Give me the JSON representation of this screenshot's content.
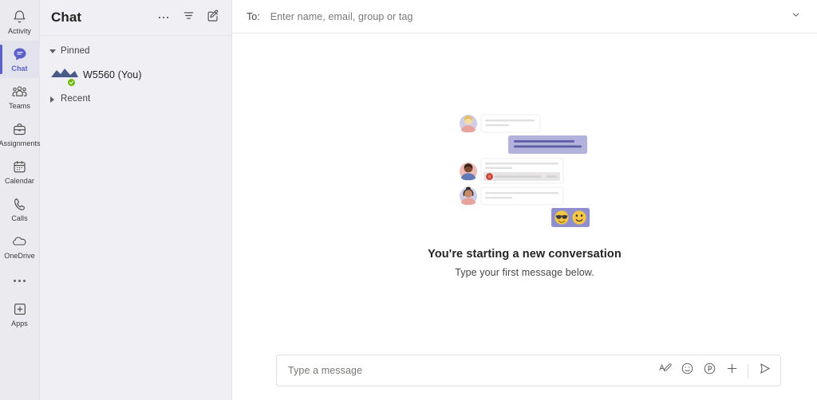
{
  "app": {
    "accent_color": "#5b5fc7",
    "rail_bg": "#ebebef",
    "list_bg": "#f0f0f4",
    "main_bg": "#ffffff"
  },
  "rail": {
    "items": [
      {
        "label": "Activity",
        "icon": "bell-icon",
        "active": false
      },
      {
        "label": "Chat",
        "icon": "chat-bubble-icon",
        "active": true
      },
      {
        "label": "Teams",
        "icon": "teams-people-icon",
        "active": false
      },
      {
        "label": "Assignments",
        "icon": "assignments-bag-icon",
        "active": false
      },
      {
        "label": "Calendar",
        "icon": "calendar-icon",
        "active": false
      },
      {
        "label": "Calls",
        "icon": "phone-icon",
        "active": false
      },
      {
        "label": "OneDrive",
        "icon": "cloud-icon",
        "active": false
      }
    ],
    "more_icon": "ellipsis-icon",
    "apps": {
      "label": "Apps",
      "icon": "apps-plus-box-icon"
    }
  },
  "chat_list": {
    "title": "Chat",
    "header_actions": [
      {
        "name": "more-options",
        "icon": "ellipsis-icon",
        "tooltip": "More options"
      },
      {
        "name": "filter",
        "icon": "filter-icon",
        "tooltip": "Filter"
      },
      {
        "name": "new-chat",
        "icon": "compose-pencil-icon",
        "tooltip": "New chat"
      }
    ],
    "groups": [
      {
        "label": "Pinned",
        "expanded": true,
        "chevron": "triangle-down-icon",
        "items": [
          {
            "name": "W5560 (You)",
            "avatar": "landscape-photo-avatar",
            "presence": "available"
          }
        ]
      },
      {
        "label": "Recent",
        "expanded": false,
        "chevron": "triangle-right-icon",
        "items": []
      }
    ]
  },
  "main": {
    "to_bar": {
      "label": "To:",
      "value": "",
      "placeholder": "Enter name, email, group or tag",
      "expand_icon": "chevron-down-icon"
    },
    "empty_state": {
      "illustration": "new-conversation-illustration",
      "title": "You're starting a new conversation",
      "subtitle": "Type your first message below."
    },
    "composer": {
      "value": "",
      "placeholder": "Type a message",
      "actions": [
        {
          "name": "format",
          "icon": "format-pencil-icon"
        },
        {
          "name": "emoji",
          "icon": "smiley-icon"
        },
        {
          "name": "giphy",
          "icon": "giphy-icon"
        },
        {
          "name": "attach",
          "icon": "plus-icon"
        },
        {
          "name": "send",
          "icon": "send-paper-plane-icon"
        }
      ]
    }
  },
  "illustration_colors": {
    "bubble_purple": "#b2b2dd",
    "bubble_purple_line": "#5b5ea6",
    "card_border": "#eceaea",
    "card_line": "#e3e1e1",
    "emoji_bg": "#8f8fd0",
    "file_icon_red": "#c0392b"
  }
}
